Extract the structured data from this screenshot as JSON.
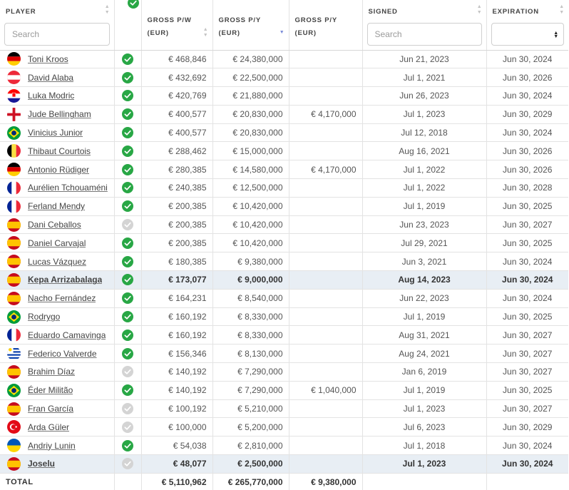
{
  "columns": {
    "player": "PLAYER",
    "gross_pw": "GROSS P/W (EUR)",
    "gross_py": "GROSS P/Y (EUR)",
    "gross_py2": "GROSS P/Y (EUR)",
    "signed": "SIGNED",
    "expiration": "EXPIRATION"
  },
  "filters": {
    "player_placeholder": "Search",
    "signed_placeholder": "Search",
    "expiration_value": ""
  },
  "rows": [
    {
      "name": "Toni Kroos",
      "flag": "germany",
      "active": true,
      "pw": "€ 468,846",
      "py": "€ 24,380,000",
      "py2": "",
      "signed": "Jun 21, 2023",
      "exp": "Jun 30, 2024",
      "hl": false
    },
    {
      "name": "David Alaba",
      "flag": "austria",
      "active": true,
      "pw": "€ 432,692",
      "py": "€ 22,500,000",
      "py2": "",
      "signed": "Jul 1, 2021",
      "exp": "Jun 30, 2026",
      "hl": false
    },
    {
      "name": "Luka Modric",
      "flag": "croatia",
      "active": true,
      "pw": "€ 420,769",
      "py": "€ 21,880,000",
      "py2": "",
      "signed": "Jun 26, 2023",
      "exp": "Jun 30, 2024",
      "hl": false
    },
    {
      "name": "Jude Bellingham",
      "flag": "england",
      "active": true,
      "pw": "€ 400,577",
      "py": "€ 20,830,000",
      "py2": "€ 4,170,000",
      "signed": "Jul 1, 2023",
      "exp": "Jun 30, 2029",
      "hl": false
    },
    {
      "name": "Vinicius Junior",
      "flag": "brazil",
      "active": true,
      "pw": "€ 400,577",
      "py": "€ 20,830,000",
      "py2": "",
      "signed": "Jul 12, 2018",
      "exp": "Jun 30, 2024",
      "hl": false
    },
    {
      "name": "Thibaut Courtois",
      "flag": "belgium",
      "active": true,
      "pw": "€ 288,462",
      "py": "€ 15,000,000",
      "py2": "",
      "signed": "Aug 16, 2021",
      "exp": "Jun 30, 2026",
      "hl": false
    },
    {
      "name": "Antonio Rüdiger",
      "flag": "germany",
      "active": true,
      "pw": "€ 280,385",
      "py": "€ 14,580,000",
      "py2": "€ 4,170,000",
      "signed": "Jul 1, 2022",
      "exp": "Jun 30, 2026",
      "hl": false
    },
    {
      "name": "Aurélien Tchouaméni",
      "flag": "france",
      "active": true,
      "pw": "€ 240,385",
      "py": "€ 12,500,000",
      "py2": "",
      "signed": "Jul 1, 2022",
      "exp": "Jun 30, 2028",
      "hl": false
    },
    {
      "name": "Ferland Mendy",
      "flag": "france",
      "active": true,
      "pw": "€ 200,385",
      "py": "€ 10,420,000",
      "py2": "",
      "signed": "Jul 1, 2019",
      "exp": "Jun 30, 2025",
      "hl": false
    },
    {
      "name": "Dani Ceballos",
      "flag": "spain",
      "active": false,
      "pw": "€ 200,385",
      "py": "€ 10,420,000",
      "py2": "",
      "signed": "Jun 23, 2023",
      "exp": "Jun 30, 2027",
      "hl": false
    },
    {
      "name": "Daniel Carvajal",
      "flag": "spain",
      "active": true,
      "pw": "€ 200,385",
      "py": "€ 10,420,000",
      "py2": "",
      "signed": "Jul 29, 2021",
      "exp": "Jun 30, 2025",
      "hl": false
    },
    {
      "name": "Lucas Vázquez",
      "flag": "spain",
      "active": true,
      "pw": "€ 180,385",
      "py": "€ 9,380,000",
      "py2": "",
      "signed": "Jun 3, 2021",
      "exp": "Jun 30, 2024",
      "hl": false
    },
    {
      "name": "Kepa Arrizabalaga",
      "flag": "spain",
      "active": true,
      "pw": "€ 173,077",
      "py": "€ 9,000,000",
      "py2": "",
      "signed": "Aug 14, 2023",
      "exp": "Jun 30, 2024",
      "hl": true
    },
    {
      "name": "Nacho Fernández",
      "flag": "spain",
      "active": true,
      "pw": "€ 164,231",
      "py": "€ 8,540,000",
      "py2": "",
      "signed": "Jun 22, 2023",
      "exp": "Jun 30, 2024",
      "hl": false
    },
    {
      "name": "Rodrygo",
      "flag": "brazil",
      "active": true,
      "pw": "€ 160,192",
      "py": "€ 8,330,000",
      "py2": "",
      "signed": "Jul 1, 2019",
      "exp": "Jun 30, 2025",
      "hl": false
    },
    {
      "name": "Eduardo Camavinga",
      "flag": "france",
      "active": true,
      "pw": "€ 160,192",
      "py": "€ 8,330,000",
      "py2": "",
      "signed": "Aug 31, 2021",
      "exp": "Jun 30, 2027",
      "hl": false
    },
    {
      "name": "Federico Valverde",
      "flag": "uruguay",
      "active": true,
      "pw": "€ 156,346",
      "py": "€ 8,130,000",
      "py2": "",
      "signed": "Aug 24, 2021",
      "exp": "Jun 30, 2027",
      "hl": false
    },
    {
      "name": "Brahim Díaz",
      "flag": "spain",
      "active": false,
      "pw": "€ 140,192",
      "py": "€ 7,290,000",
      "py2": "",
      "signed": "Jan 6, 2019",
      "exp": "Jun 30, 2027",
      "hl": false
    },
    {
      "name": "Éder Militão",
      "flag": "brazil",
      "active": true,
      "pw": "€ 140,192",
      "py": "€ 7,290,000",
      "py2": "€ 1,040,000",
      "signed": "Jul 1, 2019",
      "exp": "Jun 30, 2025",
      "hl": false
    },
    {
      "name": "Fran García",
      "flag": "spain",
      "active": false,
      "pw": "€ 100,192",
      "py": "€ 5,210,000",
      "py2": "",
      "signed": "Jul 1, 2023",
      "exp": "Jun 30, 2027",
      "hl": false
    },
    {
      "name": "Arda Güler",
      "flag": "turkey",
      "active": false,
      "pw": "€ 100,000",
      "py": "€ 5,200,000",
      "py2": "",
      "signed": "Jul 6, 2023",
      "exp": "Jun 30, 2029",
      "hl": false
    },
    {
      "name": "Andriy Lunin",
      "flag": "ukraine",
      "active": true,
      "pw": "€ 54,038",
      "py": "€ 2,810,000",
      "py2": "",
      "signed": "Jul 1, 2018",
      "exp": "Jun 30, 2024",
      "hl": false
    },
    {
      "name": "Joselu",
      "flag": "spain",
      "active": false,
      "pw": "€ 48,077",
      "py": "€ 2,500,000",
      "py2": "",
      "signed": "Jul 1, 2023",
      "exp": "Jun 30, 2024",
      "hl": true
    }
  ],
  "totals": {
    "label": "TOTAL",
    "pw": "€ 5,110,962",
    "py": "€ 265,770,000",
    "py2": "€ 9,380,000"
  },
  "colors": {
    "active_check": "#28a745",
    "inactive_check": "#d4d4d4",
    "highlight_row": "#e8eef4",
    "sort_active": "#7b8bd8"
  }
}
